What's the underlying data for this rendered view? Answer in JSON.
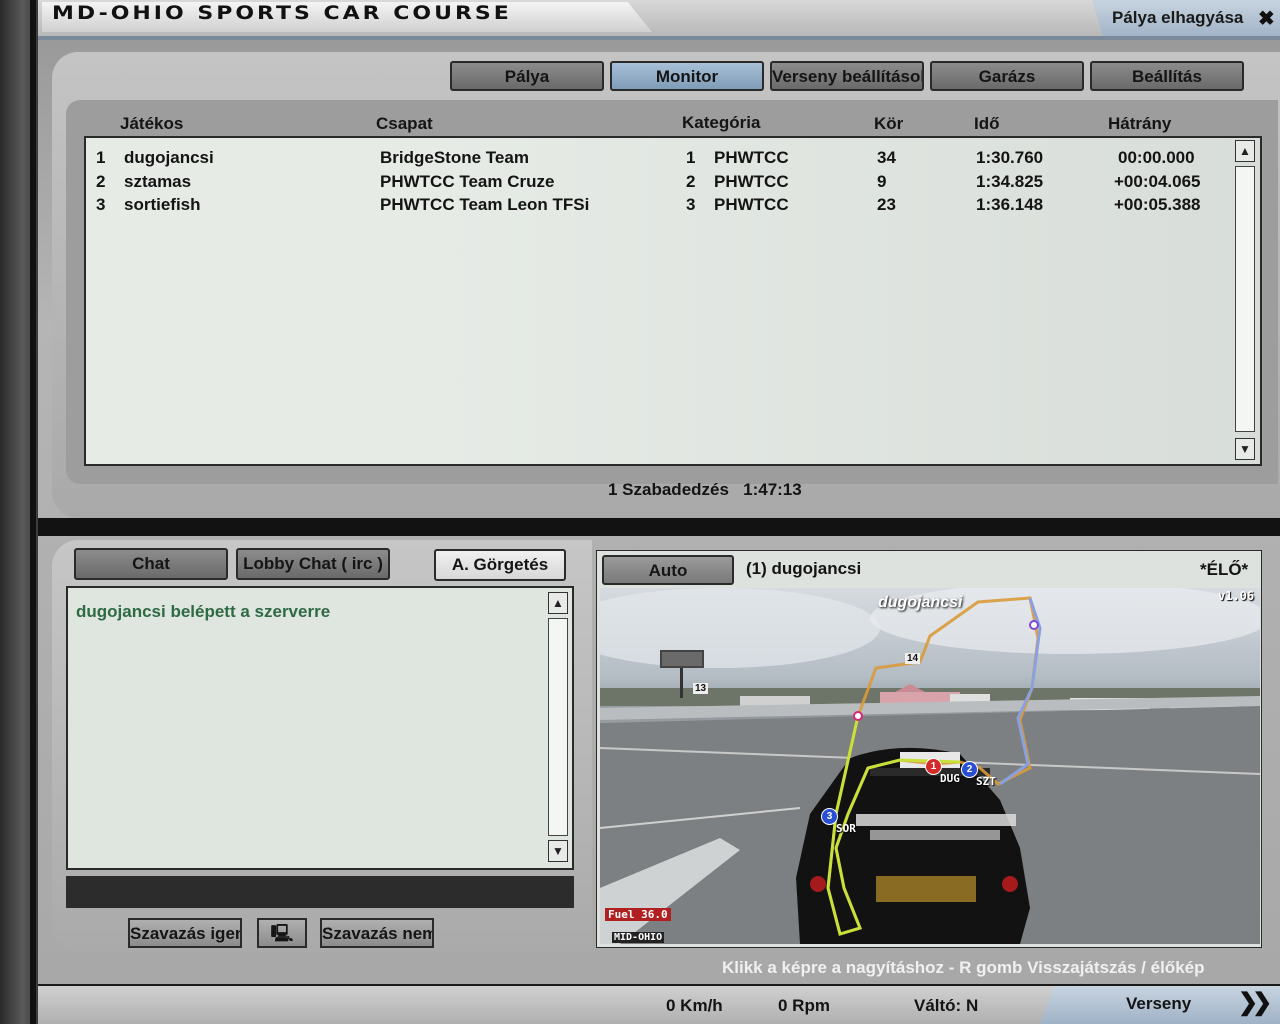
{
  "window": {
    "track_title": "MD-OHIO SPORTS CAR COURSE",
    "leave_track": "Pálya elhagyása",
    "leave_icon": "close-x-icon"
  },
  "tabs": [
    {
      "label": "Pálya",
      "active": false
    },
    {
      "label": "Monitor",
      "active": true
    },
    {
      "label": "Verseny beállítások",
      "active": false
    },
    {
      "label": "Garázs",
      "active": false
    },
    {
      "label": "Beállítás",
      "active": false
    }
  ],
  "results": {
    "headers": {
      "player": "Játékos",
      "team": "Csapat",
      "category": "Kategória",
      "lap": "Kör",
      "time": "Idő",
      "gap": "Hátrány"
    },
    "rows": [
      {
        "pos": "1",
        "player": "dugojancsi",
        "team": "BridgeStone Team",
        "cat_pos": "1",
        "category": "PHWTCC",
        "lap": "34",
        "time": "1:30.760",
        "gap": "00:00.000"
      },
      {
        "pos": "2",
        "player": "sztamas",
        "team": "PHWTCC Team Cruze",
        "cat_pos": "2",
        "category": "PHWTCC",
        "lap": "9",
        "time": "1:34.825",
        "gap": "+00:04.065"
      },
      {
        "pos": "3",
        "player": "sortiefish",
        "team": "PHWTCC Team Leon TFSi",
        "cat_pos": "3",
        "category": "PHWTCC",
        "lap": "23",
        "time": "1:36.148",
        "gap": "+00:05.388"
      }
    ]
  },
  "session": {
    "label": "1 Szabadedzés",
    "time": "1:47:13"
  },
  "chat": {
    "tab_chat": "Chat",
    "tab_lobby": "Lobby Chat ( irc )",
    "autoscroll": "A. Görgetés",
    "messages": [
      "dugojancsi belépett a szerverre"
    ],
    "vote_yes": "Szavazás igen",
    "vote_no": "Szavazás nem",
    "monitor_icon": "monitor-icon"
  },
  "camera": {
    "mode_button": "Auto",
    "target": "(1) dugojancsi",
    "live": "*ÉLŐ*",
    "version": "v1.06",
    "driver_overlay": "dugojancsi",
    "fuel": "Fuel  36.0",
    "track_tag": "MID-OHIO",
    "markers": [
      {
        "num": "1",
        "tag": "DUG",
        "color": "#d42a2a"
      },
      {
        "num": "2",
        "tag": "SZT",
        "color": "#2a4fd4"
      },
      {
        "num": "3",
        "tag": "SOR",
        "color": "#2a4fd4"
      }
    ],
    "sign_numbers": [
      "14",
      "13"
    ]
  },
  "hint": "Klikk a képre a nagyításhoz - R gomb  Visszajátszás / élőkép",
  "status": {
    "speed": "0 Km/h",
    "rpm": "0 Rpm",
    "gear": "Váltó: N",
    "race": "Verseny",
    "race_icon": "double-chevron-right-icon"
  }
}
